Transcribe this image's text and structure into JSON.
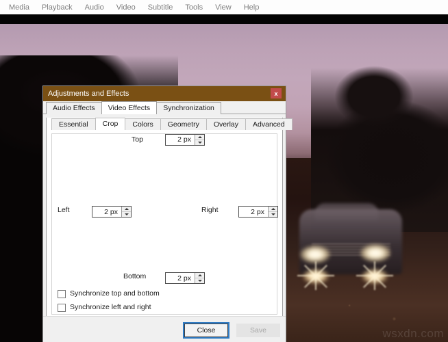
{
  "menubar": {
    "items": [
      {
        "label": "Media"
      },
      {
        "label": "Playback"
      },
      {
        "label": "Audio"
      },
      {
        "label": "Video"
      },
      {
        "label": "Subtitle"
      },
      {
        "label": "Tools"
      },
      {
        "label": "View"
      },
      {
        "label": "Help"
      }
    ]
  },
  "video": {
    "watermark": "wsxdn.com"
  },
  "dialog": {
    "title": "Adjustments and Effects",
    "close_icon": "x",
    "tabs": [
      {
        "label": "Audio Effects",
        "active": false
      },
      {
        "label": "Video Effects",
        "active": true
      },
      {
        "label": "Synchronization",
        "active": false
      }
    ],
    "subtabs": [
      {
        "label": "Essential",
        "active": false
      },
      {
        "label": "Crop",
        "active": true
      },
      {
        "label": "Colors",
        "active": false
      },
      {
        "label": "Geometry",
        "active": false
      },
      {
        "label": "Overlay",
        "active": false
      },
      {
        "label": "Advanced",
        "active": false
      }
    ],
    "crop": {
      "top": {
        "label": "Top",
        "value": "2 px"
      },
      "left": {
        "label": "Left",
        "value": "2 px"
      },
      "right": {
        "label": "Right",
        "value": "2 px"
      },
      "bottom": {
        "label": "Bottom",
        "value": "2 px"
      },
      "sync_top_bottom": {
        "label": "Synchronize top and bottom",
        "checked": false
      },
      "sync_left_right": {
        "label": "Synchronize left and right",
        "checked": false
      }
    },
    "footer": {
      "close_label": "Close",
      "save_label": "Save"
    }
  },
  "colors": {
    "titlebar": "#7a5014",
    "close_button": "#c24b4b",
    "focus_outline": "#2f7bc4",
    "dialog_bg": "#f0f0f0",
    "panel_bg": "#ffffff",
    "menu_text": "#7e7e7e"
  }
}
